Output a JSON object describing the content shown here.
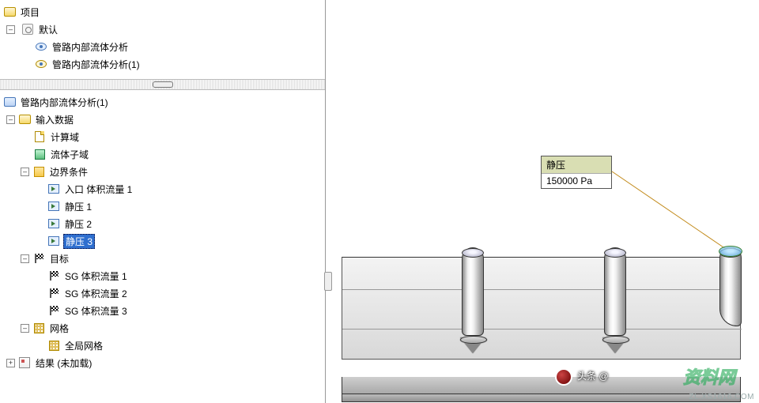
{
  "project_tree": {
    "root_label": "项目",
    "default_node": "默认",
    "configs": [
      "管路内部流体分析",
      "管路内部流体分析(1)"
    ]
  },
  "analysis_tree": {
    "title": "管路内部流体分析(1)",
    "input_data": {
      "label": "输入数据",
      "comp_domain": "计算域",
      "fluid_subdomain": "流体子域",
      "boundary": {
        "label": "边界条件",
        "items": [
          "入口 体积流量 1",
          "静压 1",
          "静压 2",
          "静压 3"
        ],
        "selected_index": 3
      },
      "goals": {
        "label": "目标",
        "items": [
          "SG 体积流量 1",
          "SG 体积流量 2",
          "SG 体积流量 3"
        ]
      },
      "mesh": {
        "label": "网格",
        "global": "全局网格"
      }
    },
    "results_label": "结果 (未加载)"
  },
  "callout": {
    "title": "静压",
    "value": "150000 Pa"
  },
  "watermark": {
    "logo_text": "资料网",
    "credit_prefix": "头条 @",
    "url": "ZL.XS1616.COM"
  },
  "icons": {
    "project": "folder-icon",
    "pin": "pin-icon",
    "eye": "eye-icon",
    "config": "config-icon",
    "analysis": "analysis-icon",
    "input": "input-folder-icon",
    "box": "box-icon",
    "cube": "cube-icon",
    "bc": "boundary-icon",
    "goal": "flag-icon",
    "mesh": "mesh-icon",
    "results": "results-icon"
  }
}
